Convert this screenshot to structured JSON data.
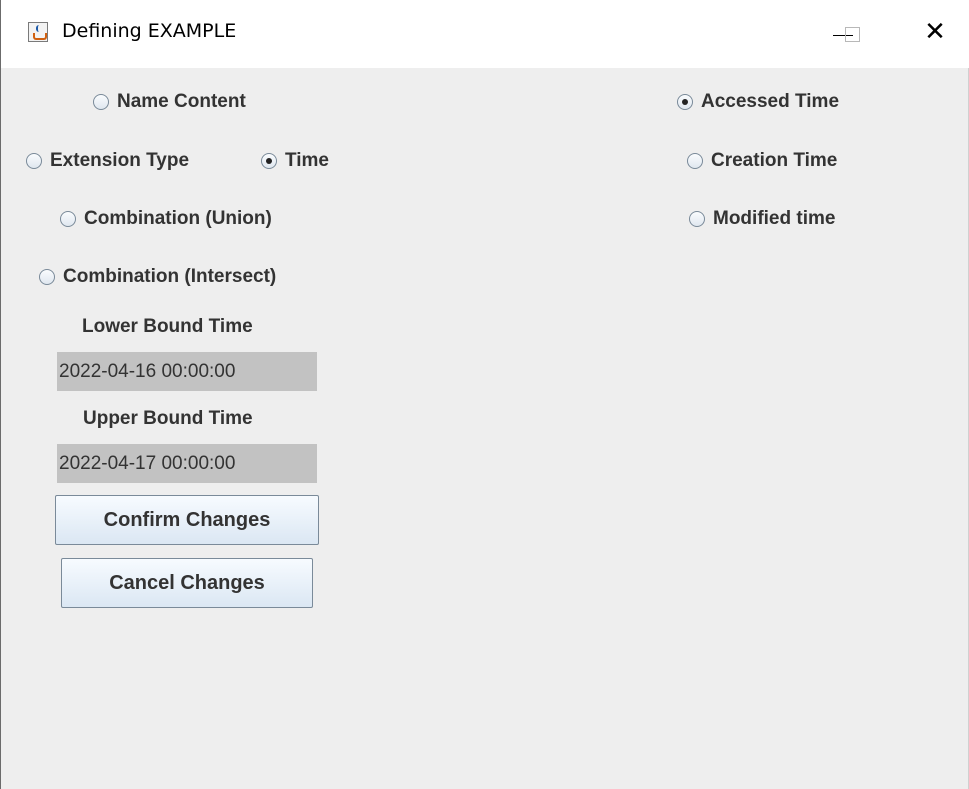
{
  "window": {
    "title": "Defining EXAMPLE",
    "controls": {
      "minimize": "minimize",
      "maximize": "maximize",
      "close": "✕"
    }
  },
  "filter_options": [
    {
      "label": "Name Content",
      "selected": false
    },
    {
      "label": "Extension Type",
      "selected": false
    },
    {
      "label": "Time",
      "selected": true
    },
    {
      "label": "Combination (Union)",
      "selected": false
    },
    {
      "label": "Combination (Intersect)",
      "selected": false
    }
  ],
  "time_options": [
    {
      "label": "Accessed Time",
      "selected": true
    },
    {
      "label": "Creation Time",
      "selected": false
    },
    {
      "label": "Modified time",
      "selected": false
    }
  ],
  "lower_bound": {
    "label": "Lower Bound Time",
    "value": "2022-04-16 00:00:00"
  },
  "upper_bound": {
    "label": "Upper Bound Time",
    "value": "2022-04-17 00:00:00"
  },
  "buttons": {
    "confirm": "Confirm Changes",
    "cancel": "Cancel Changes"
  },
  "colors": {
    "background": "#eeeeee",
    "field_background": "#c2c2c2",
    "button_top": "#f7fbff",
    "button_bottom": "#dbe7f3"
  }
}
